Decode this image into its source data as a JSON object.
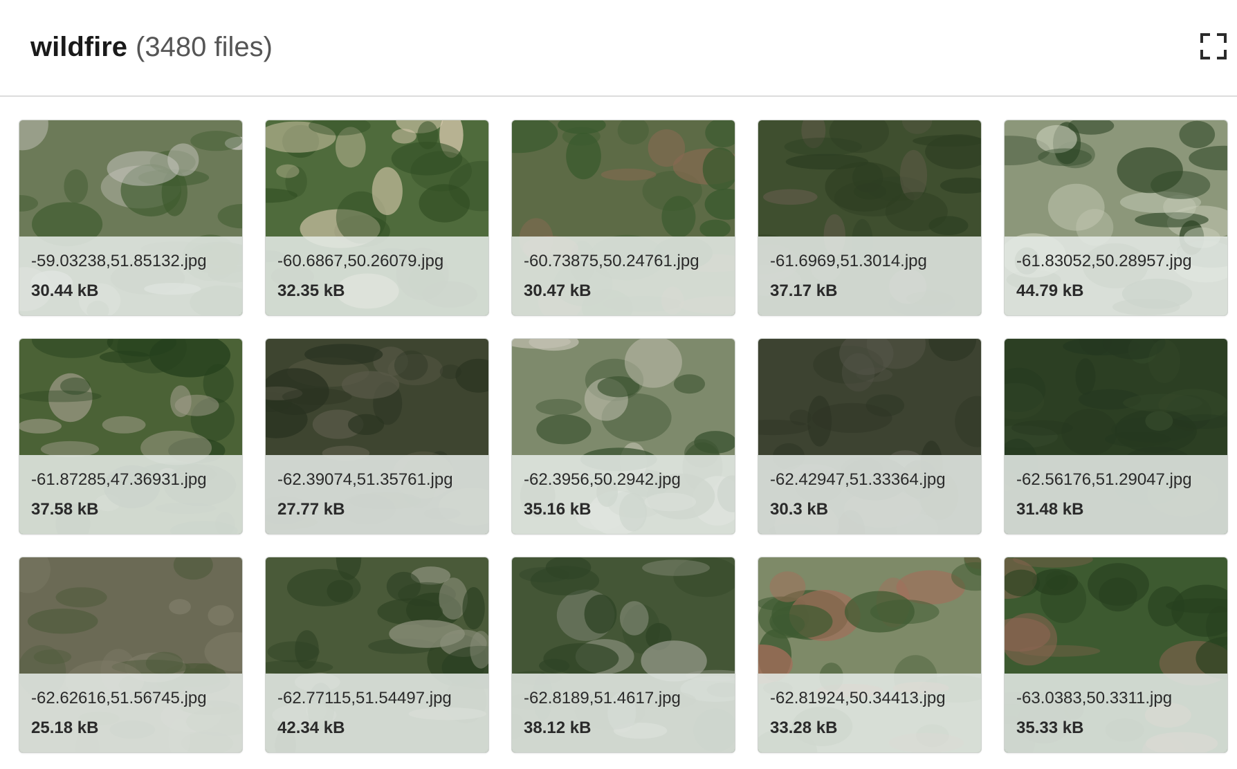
{
  "header": {
    "dataset_name": "wildfire",
    "file_count": "(3480 files)",
    "expand_icon": "fullscreen-icon"
  },
  "files": [
    {
      "name": "-59.03238,51.85132.jpg",
      "size": "30.44 kB",
      "palette": [
        "#6c7a58",
        "#3e5a2e",
        "#c9c8c1"
      ]
    },
    {
      "name": "-60.6867,50.26079.jpg",
      "size": "32.35 kB",
      "palette": [
        "#4f6b3c",
        "#2f4c22",
        "#d7c9ad"
      ]
    },
    {
      "name": "-60.73875,50.24761.jpg",
      "size": "30.47 kB",
      "palette": [
        "#5d6b46",
        "#3a5a2e",
        "#8a6a52"
      ]
    },
    {
      "name": "-61.6969,51.3014.jpg",
      "size": "37.17 kB",
      "palette": [
        "#3f4f2f",
        "#2d3e22",
        "#5e5a48"
      ]
    },
    {
      "name": "-61.83052,50.28957.jpg",
      "size": "44.79 kB",
      "palette": [
        "#8c977a",
        "#2f4727",
        "#c7ccb8"
      ]
    },
    {
      "name": "-61.87285,47.36931.jpg",
      "size": "37.58 kB",
      "palette": [
        "#4b6236",
        "#25401d",
        "#a6a08f"
      ]
    },
    {
      "name": "-62.39074,51.35761.jpg",
      "size": "27.77 kB",
      "palette": [
        "#3e4530",
        "#2a3321",
        "#5a5a48"
      ]
    },
    {
      "name": "-62.3956,50.2942.jpg",
      "size": "35.16 kB",
      "palette": [
        "#7e8a6c",
        "#3a5230",
        "#c4c2b3"
      ]
    },
    {
      "name": "-62.42947,51.33364.jpg",
      "size": "30.3 kB",
      "palette": [
        "#3d4331",
        "#2d3524",
        "#57574a"
      ]
    },
    {
      "name": "-62.56176,51.29047.jpg",
      "size": "31.48 kB",
      "palette": [
        "#2c3f23",
        "#253820",
        "#34482a"
      ]
    },
    {
      "name": "-62.62616,51.56745.jpg",
      "size": "25.18 kB",
      "palette": [
        "#6b6a55",
        "#4d5a3a",
        "#7f7c68"
      ]
    },
    {
      "name": "-62.77115,51.54497.jpg",
      "size": "42.34 kB",
      "palette": [
        "#4a5a39",
        "#2b4022",
        "#8c907c"
      ]
    },
    {
      "name": "-62.8189,51.4617.jpg",
      "size": "38.12 kB",
      "palette": [
        "#445636",
        "#2f4426",
        "#96998a"
      ]
    },
    {
      "name": "-62.81924,50.34413.jpg",
      "size": "33.28 kB",
      "palette": [
        "#7e8a68",
        "#3e5a31",
        "#a46d5a"
      ]
    },
    {
      "name": "-63.0383,50.3311.jpg",
      "size": "35.33 kB",
      "palette": [
        "#3d5a30",
        "#27401f",
        "#8a6451"
      ]
    }
  ]
}
